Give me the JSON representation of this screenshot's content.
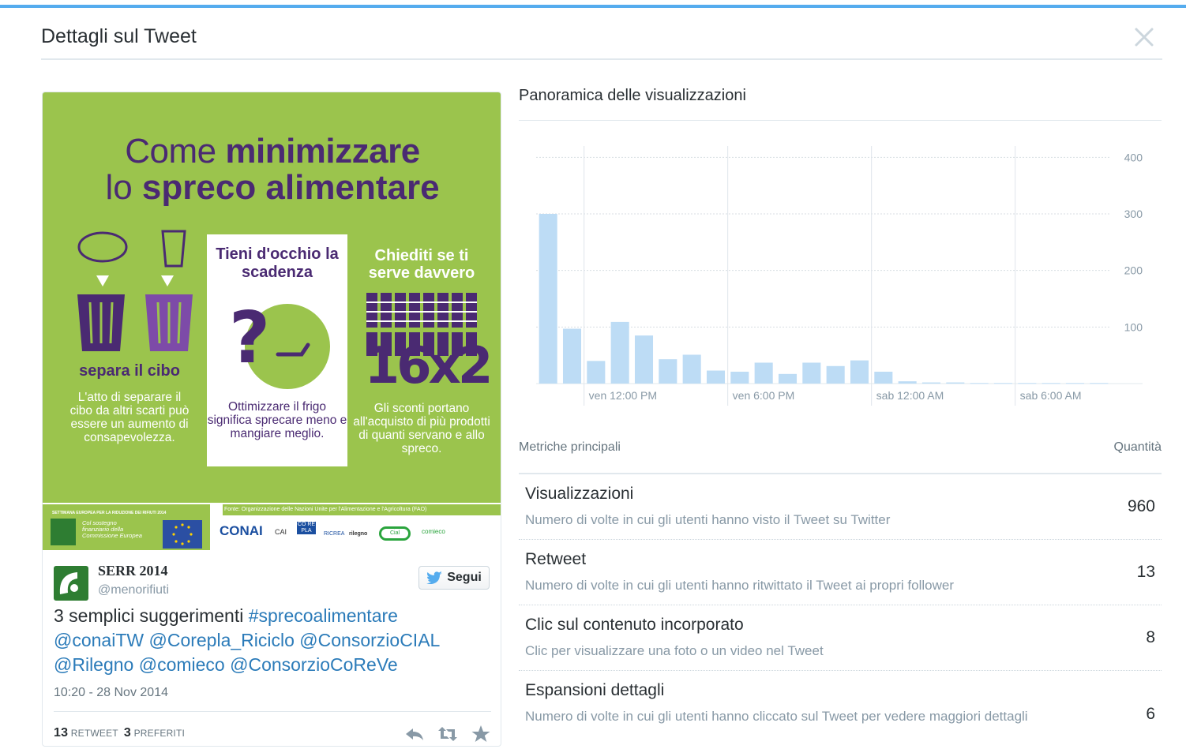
{
  "modal": {
    "title": "Dettagli sul Tweet"
  },
  "tweet": {
    "image": {
      "title_line1_light": "Come ",
      "title_line1_bold": "minimizzare",
      "title_line2_light": "lo ",
      "title_line2_bold": "spreco alimentare",
      "col1_head": "separa il cibo",
      "col1_body": "L'atto di separare il cibo da altri scarti può essere un aumento di consapevolezza.",
      "col2_head": "Tieni d'occhio la scadenza",
      "col2_body": "Ottimizzare il frigo significa sprecare meno e mangiare meglio.",
      "col3_head": "Chiediti se ti serve davvero",
      "col3_big": "16x2",
      "col3_body": "Gli sconti portano all'acquisto di più prodotti di quanti servano e allo spreco.",
      "source": "Fonte: Organizzazione delle Nazioni Unite per l'Alimentazione e l'Agricoltura (FAO)",
      "serr_label": "SETTIMANA EUROPEA PER LA RIDUZIONE DEI RIFIUTI 2014",
      "serr_sub": "Col sostegno finanziario della Commissione Europea",
      "logos": [
        "CONAI",
        "CAI",
        "CO RE PLA",
        "RICREA",
        "rilegno",
        "Cial",
        "comieco"
      ]
    },
    "author_name": "SERR 2014",
    "author_handle": "@menorifiuti",
    "follow_label": "Segui",
    "text_plain": "3 semplici suggerimenti ",
    "text_links": [
      "#sprecoalimentare",
      "@conaiTW",
      "@Corepla_Riciclo",
      "@ConsorzioCIAL",
      "@Rilegno",
      "@comieco",
      "@ConsorzioCoReVe"
    ],
    "timestamp": "10:20 - 28 Nov 2014",
    "retweets_count": "13",
    "retweets_label": "RETWEET",
    "favorites_count": "3",
    "favorites_label": "PREFERITI"
  },
  "overview": {
    "title": "Panoramica delle visualizzazioni"
  },
  "chart_data": {
    "type": "bar",
    "y_ticks": [
      100,
      200,
      300,
      400
    ],
    "ylim": [
      0,
      420
    ],
    "x_tick_labels": [
      "ven 12:00 PM",
      "ven 6:00 PM",
      "sab 12:00 AM",
      "sab 6:00 AM"
    ],
    "values": [
      300,
      97,
      40,
      109,
      85,
      43,
      51,
      23,
      21,
      37,
      17,
      37,
      31,
      41,
      21,
      4,
      2,
      2,
      1,
      1,
      1,
      1,
      1,
      1
    ],
    "grid": true,
    "bar_color": "#bddcf5",
    "y_axis_position": "right"
  },
  "metrics": {
    "header_left": "Metriche principali",
    "header_right": "Quantità",
    "rows": [
      {
        "name": "Visualizzazioni",
        "desc": "Numero di volte in cui gli utenti hanno visto il Tweet su Twitter",
        "value": "960"
      },
      {
        "name": "Retweet",
        "desc": "Numero di volte in cui gli utenti hanno ritwittato il Tweet ai propri follower",
        "value": "13"
      },
      {
        "name": "Clic sul contenuto incorporato",
        "desc": "Clic per visualizzare una foto o un video nel Tweet",
        "value": "8"
      },
      {
        "name": "Espansioni dettagli",
        "desc": "Numero di volte in cui gli utenti hanno cliccato sul Tweet per vedere maggiori dettagli",
        "value": "6"
      }
    ]
  },
  "colors": {
    "accent": "#55acee",
    "image_green": "#9bc44d",
    "image_purple": "#4a2a72",
    "link": "#2b7bb9"
  }
}
